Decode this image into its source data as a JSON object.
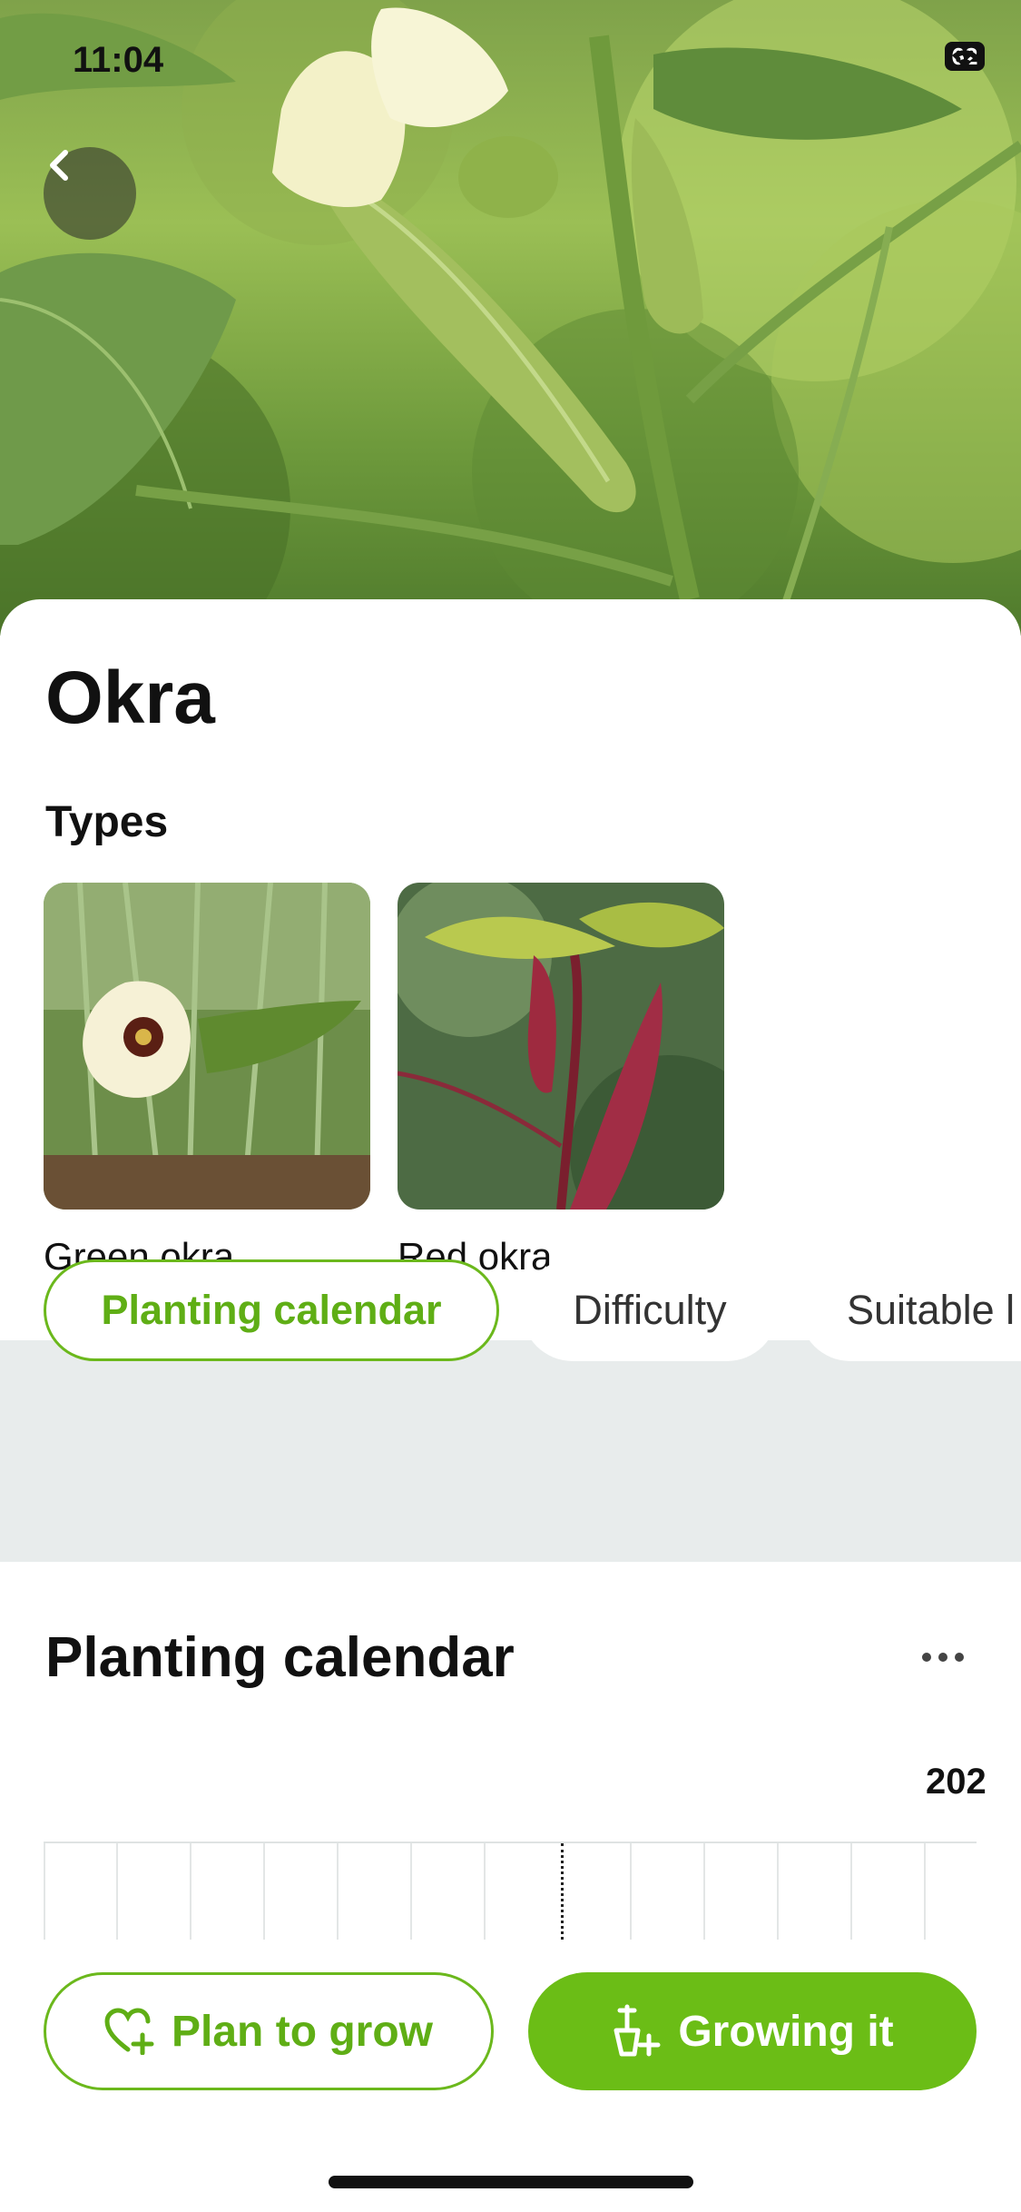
{
  "status_bar": {
    "time": "11:04",
    "battery": "62"
  },
  "hero": {
    "back_icon": "chevron-left-icon"
  },
  "plant": {
    "name": "Okra"
  },
  "types": {
    "heading": "Types",
    "items": [
      {
        "label": "Green okra"
      },
      {
        "label": "Red okra"
      }
    ]
  },
  "chips": [
    {
      "label": "Planting calendar",
      "active": true
    },
    {
      "label": "Difficulty",
      "active": false
    },
    {
      "label": "Suitable l",
      "active": false
    }
  ],
  "planting_calendar": {
    "title": "Planting calendar",
    "year_label": "202"
  },
  "actions": {
    "plan_label": "Plan to grow",
    "grow_label": "Growing it"
  },
  "colors": {
    "accent": "#6bbd16",
    "chip_band": "#e8ecec"
  }
}
